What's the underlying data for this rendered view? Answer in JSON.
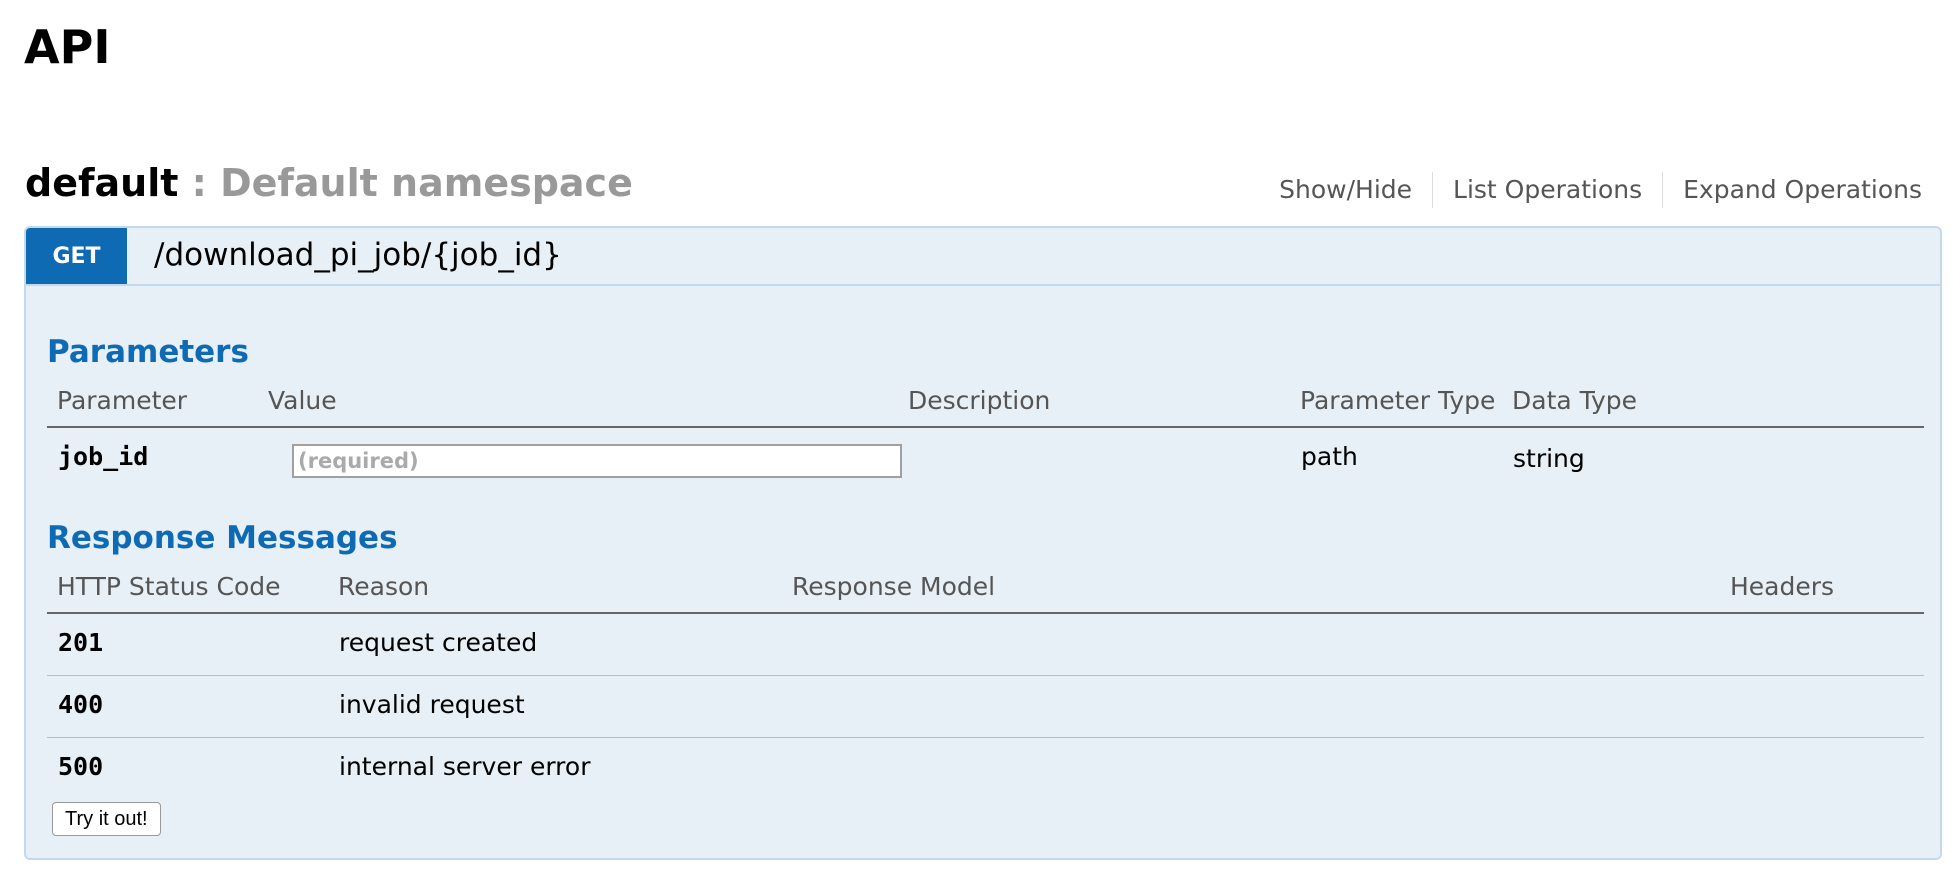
{
  "page": {
    "title": "API"
  },
  "namespace": {
    "name": "default",
    "separator": " : ",
    "description": "Default namespace",
    "controls": [
      "Show/Hide",
      "List Operations",
      "Expand Operations"
    ]
  },
  "operation": {
    "method": "GET",
    "path": "/download_pi_job/{job_id}",
    "accent_color": "#0f6ab4",
    "parameters": {
      "title": "Parameters",
      "headers": [
        "Parameter",
        "Value",
        "Description",
        "Parameter Type",
        "Data Type"
      ],
      "rows": [
        {
          "name": "job_id",
          "value": "",
          "placeholder": "(required)",
          "description": "",
          "param_type": "path",
          "data_type": "string"
        }
      ]
    },
    "responses": {
      "title": "Response Messages",
      "headers": [
        "HTTP Status Code",
        "Reason",
        "Response Model",
        "Headers"
      ],
      "rows": [
        {
          "code": "201",
          "reason": "request created",
          "model": "",
          "headers": ""
        },
        {
          "code": "400",
          "reason": "invalid request",
          "model": "",
          "headers": ""
        },
        {
          "code": "500",
          "reason": "internal server error",
          "model": "",
          "headers": ""
        }
      ]
    },
    "try_button": "Try it out!"
  }
}
